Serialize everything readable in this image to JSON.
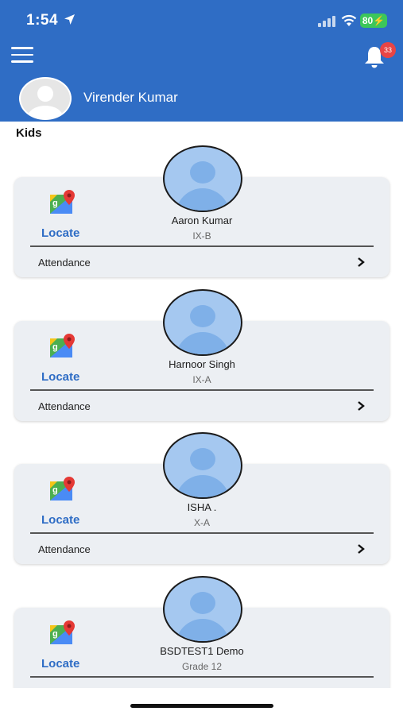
{
  "status_bar": {
    "time": "1:54",
    "battery": "80"
  },
  "header": {
    "notification_count": "33",
    "user_name": "Virender Kumar"
  },
  "section_title": "Kids",
  "locate_label": "Locate",
  "attendance_label": "Attendance",
  "kids": [
    {
      "name": "Aaron Kumar",
      "class": "IX-B"
    },
    {
      "name": "Harnoor Singh",
      "class": "IX-A"
    },
    {
      "name": "ISHA .",
      "class": "X-A"
    },
    {
      "name": "BSDTEST1 Demo",
      "class": "Grade 12"
    }
  ],
  "colors": {
    "header_bg": "#2f6dc5",
    "accent": "#2f6dc5",
    "badge": "#e84545",
    "battery": "#3cc65a"
  }
}
